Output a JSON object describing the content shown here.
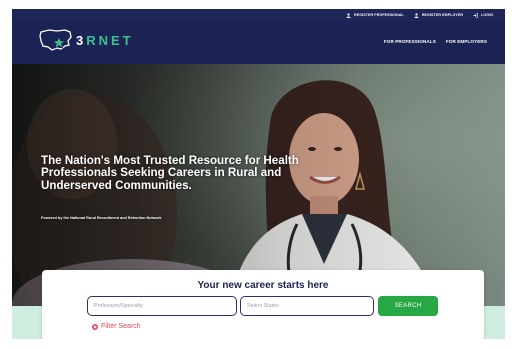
{
  "utility_bar": {
    "register_professional": "REGISTER PROFESSIONAL",
    "register_employer": "REGISTER EMPLOYER",
    "login": "LOGIN"
  },
  "brand": {
    "prefix": "3",
    "name": "RNET"
  },
  "nav": {
    "for_professionals": "FOR PROFESSIONALS",
    "for_employers": "FOR EMPLOYERS"
  },
  "hero": {
    "headline": "The Nation's Most Trusted Resource for Health Professionals Seeking Careers in Rural and Underserved Communities.",
    "powered_by": "Powered by the National Rural Recruitment and Retention Network"
  },
  "search": {
    "title": "Your new career starts here",
    "profession_placeholder": "Profession/Specialty",
    "states_placeholder": "Select States",
    "button_label": "SEARCH",
    "filter_label": "Filter Search"
  },
  "colors": {
    "navy": "#1b2354",
    "brand_green": "#3fc08e",
    "search_green": "#28a745",
    "filter_red": "#e04a5a",
    "mint": "#cfeee0"
  },
  "icons": {
    "register_professional": "person-icon",
    "register_employer": "person-icon",
    "login": "login-arrow-icon",
    "filter": "x-circle-icon",
    "logo": "us-map-star-icon"
  }
}
